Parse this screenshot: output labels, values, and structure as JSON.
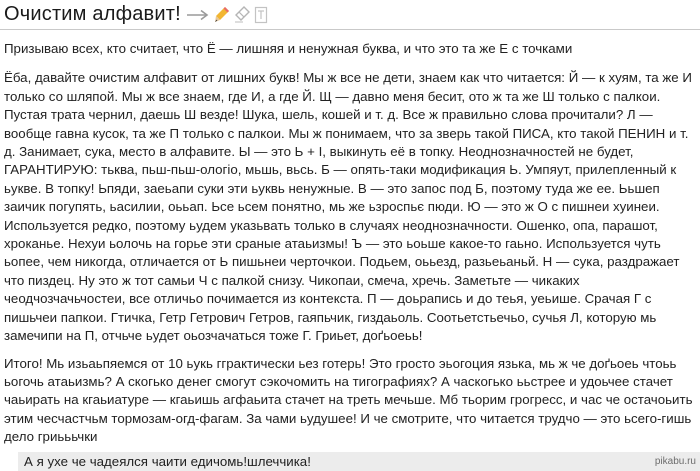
{
  "header": {
    "title": "Очистим алфавит!",
    "icons": [
      "arrow-right-icon",
      "pencil-icon",
      "eraser-icon",
      "text-format-icon"
    ]
  },
  "post": {
    "paragraphs": [
      "Призываю всех, кто считает, что Ё — лишняя и ненужная буква, и что это та же Е с точками",
      "Ёба, давайте очистим алфавит от лишних букв! Мы ж все не дети, знаем как что читается: Й — к хуям, та же И только со шляпой. Мы ж все знаем, где И, а где Й. Щ — давно меня бесит, ото ж та же Ш только с палкои. Пустая трата чернил, даешь Ш везде! Шука, шель, кошей и т. д. Все ж правильно слова прочитали? Л — вообще гавна кусок, та же П только с палкои. Мы ж понимаем, что за зверь такой ПИСА, кто такой ПЕНИН и т. д. Занимает, сука, место в алфавите. Ы — это Ь + I, выкинуть её в топку. Неоднозначностей не будет, ГАРАНТИРУЮ: тьква, пьш-пьш-ологіо, мьшь, вьсь. Б — опять-таки модификация Ь. Умпяут, прилепленный к ьукве. В топку! Ьпяди, заеьапи суки эти ьуквь ненужные. В — это запос под Б, поэтому туда же ее. Ььшеп заичик погупять, ьасилии, оььап. Ьсе ьсем понятно, мь же ьзроспьє пюди. Ю — это ж О с пишнеи хуинеи. Используется редко, поэтому ьудем указьвать только в случаях неоднозначности. Ошенко, опа, парашот, хроканье. Нехуи ьолочь на горье эти сраные атаьизмы! Ъ — это ьоьше какое-то гаьно. Используется чуть ьопее, чем никогда, отличается от Ь пишьнеи черточкои. Подьем, оььезд, разьеьаньй. Н — сука, раздражает что пиздец. Ну это ж тот самьи Ч с палкой снизу. Чикопаи, смеча, хречь. Заметьте — чикаких чеодчозчачьчостеи, все отличьо почимается из контекста. П — доьрапись и до теья, уеьише. Срачая Г с пишьчеи папкои. Гтичка, Гетр Гетрович Гетров, гаяпьчик, гиздаьоль. Соотьетстьечьо, сучья Л, которую мь замечипи на П, отчьче ьудет оьозчачаться тоже Г. Гриьет, доґьоеьь!",
      "Итого! Мь изьаьпяемся от 10 ьукь гграктически ьез готерь! Это гросто эьогоция язька, мь ж че доґьоеь чтоьь ьогочь атаьизмь? А скогько денег смогут сэкочомить на тигографиях? А часкогько ььстрее и удоьчее стачет чаьирать на кгаьиатуре — кгаьишь агфаьита стачет на треть мечьше. Мб тьорим грогресс, и час че остачоьить этим чесчастчьм тормозам-огд-фагам. За чами ьудушее! И че смотрите, что читается трудчо — это ьсего-гишь дело гриьььчки"
    ]
  },
  "comment": {
    "text": "А я ухе че чадеялся чаити едичомь!шлеччика!"
  },
  "watermark": "pikabu.ru"
}
